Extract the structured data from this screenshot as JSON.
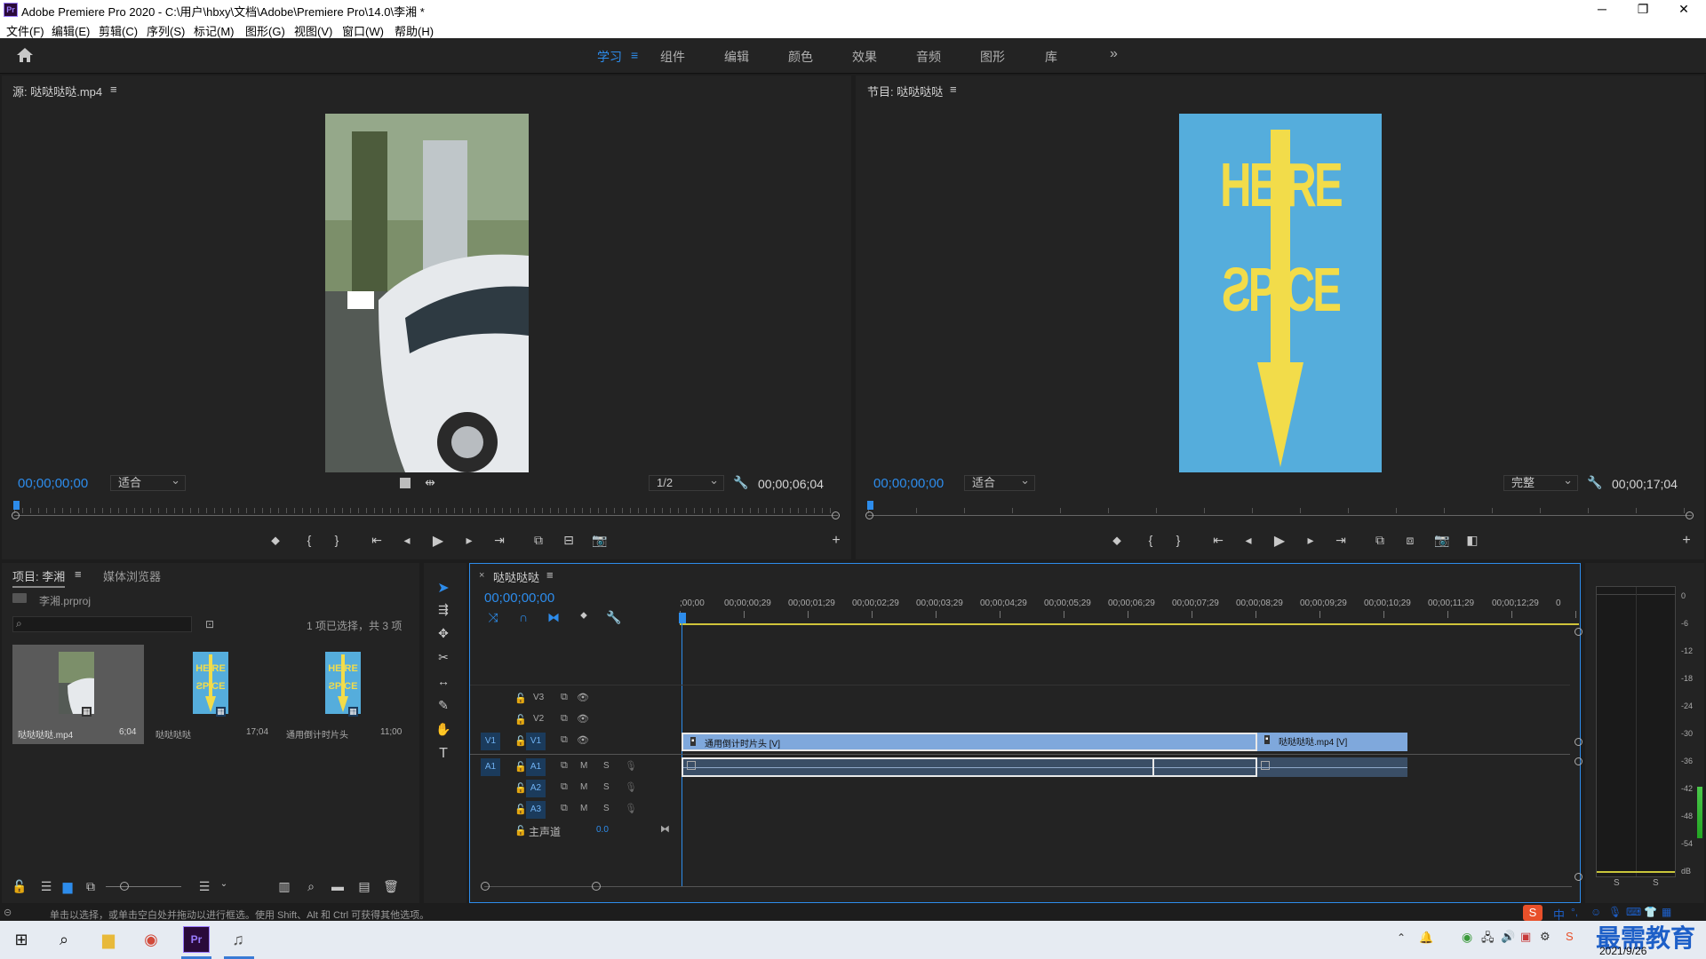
{
  "titlebar": {
    "title": "Adobe Premiere Pro 2020 - C:\\用户\\hbxy\\文档\\Adobe\\Premiere Pro\\14.0\\李湘 *",
    "app_badge": "Pr",
    "minimize": "─",
    "maximize": "❐",
    "close": "✕"
  },
  "menu": [
    "文件(F)",
    "编辑(E)",
    "剪辑(C)",
    "序列(S)",
    "标记(M)",
    "图形(G)",
    "视图(V)",
    "窗口(W)",
    "帮助(H)"
  ],
  "workspaces": {
    "items": [
      "学习",
      "组件",
      "编辑",
      "颜色",
      "效果",
      "音频",
      "图形",
      "库"
    ],
    "active_index": 0,
    "more": "»",
    "menu_glyph": "≡"
  },
  "source_monitor": {
    "title": "源: 哒哒哒哒.mp4",
    "menu_glyph": "≡",
    "timecode": "00;00;00;00",
    "fit": "适合",
    "resolution": "1/2",
    "duration": "00;00;06;04"
  },
  "program_monitor": {
    "title": "节目: 哒哒哒哒",
    "menu_glyph": "≡",
    "timecode": "00;00;00;00",
    "fit": "适合",
    "quality": "完整",
    "duration": "00;00;17;04",
    "graphic_text_top": "HE RE",
    "graphic_text_bottom": "ƧP CE",
    "graphic_bg": "#55addc",
    "graphic_fg": "#f2dc4a"
  },
  "project": {
    "tab_project": "项目: 李湘",
    "tab_media": "媒体浏览器",
    "menu_glyph": "≡",
    "file_name": "李湘.prproj",
    "selection_status": "1 项已选择，共 3 项",
    "items": [
      {
        "name": "哒哒哒哒.mp4",
        "duration": "6;04"
      },
      {
        "name": "哒哒哒哒",
        "duration": "17;04"
      },
      {
        "name": "通用倒计时片头",
        "duration": "11;00"
      }
    ]
  },
  "timeline": {
    "tab_title": "哒哒哒哒",
    "close_glyph": "×",
    "menu_glyph": "≡",
    "timecode": "00;00;00;00",
    "ruler_labels": [
      ";00;00",
      "00;00;00;29",
      "00;00;01;29",
      "00;00;02;29",
      "00;00;03;29",
      "00;00;04;29",
      "00;00;05;29",
      "00;00;06;29",
      "00;00;07;29",
      "00;00;08;29",
      "00;00;09;29",
      "00;00;10;29",
      "00;00;11;29",
      "00;00;12;29",
      "0"
    ],
    "video_tracks": [
      "V3",
      "V2",
      "V1"
    ],
    "audio_tracks": [
      "A1",
      "A2",
      "A3"
    ],
    "source_v": "V1",
    "source_a": "A1",
    "master_label": "主声道",
    "master_value": "0.0",
    "clip1_label": "通用倒计时片头 [V]",
    "clip2_label": "哒哒哒哒.mp4 [V]",
    "mute_label": "M",
    "solo_label": "S"
  },
  "audio_meter": {
    "scale": [
      "0",
      "-6",
      "-12",
      "-18",
      "-24",
      "-30",
      "-36",
      "-42",
      "-48",
      "-54",
      "dB"
    ],
    "solo_labels": [
      "S",
      "S"
    ]
  },
  "status_bar": "单击以选择，或单击空白处并拖动以进行框选。使用 Shift、Alt 和 Ctrl 可获得其他选项。",
  "taskbar": {
    "date": "2021/9/26",
    "watermark": "最需教育",
    "ime": "中",
    "ime_extra": "°,",
    "sogou_badge": "S"
  }
}
